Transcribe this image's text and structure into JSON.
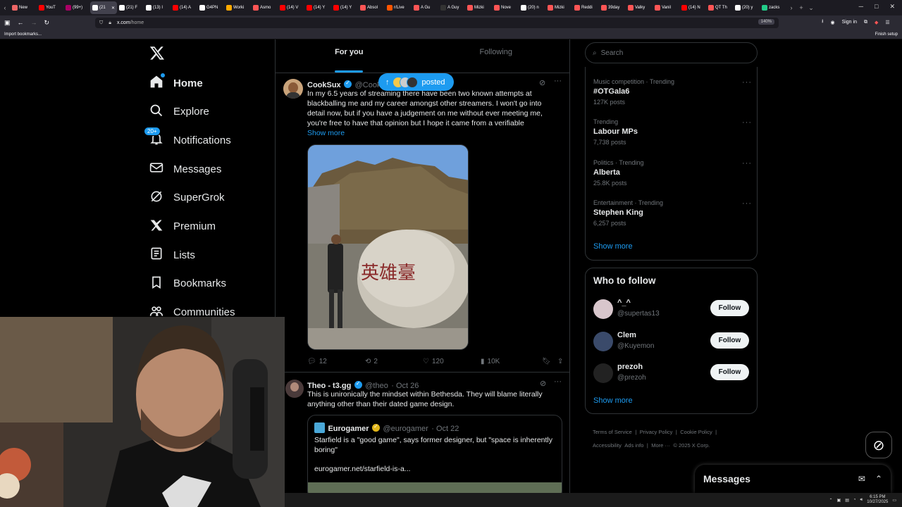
{
  "browser": {
    "tabs": [
      {
        "label": "New",
        "color": "#e66"
      },
      {
        "label": "YouT",
        "color": "#f00"
      },
      {
        "label": "(99+)",
        "color": "#a06"
      },
      {
        "label": "(21",
        "color": "#fff",
        "active": true
      },
      {
        "label": "(21) F",
        "color": "#fff"
      },
      {
        "label": "(13) I",
        "color": "#fff"
      },
      {
        "label": "(14) A",
        "color": "#f00"
      },
      {
        "label": "G4PN",
        "color": "#fff"
      },
      {
        "label": "Worki",
        "color": "#fa0"
      },
      {
        "label": "Asmo",
        "color": "#f55"
      },
      {
        "label": "(14) V",
        "color": "#f00"
      },
      {
        "label": "(14) Y",
        "color": "#f00"
      },
      {
        "label": "(14) Y",
        "color": "#f00"
      },
      {
        "label": "Absol",
        "color": "#f55"
      },
      {
        "label": "r/Live",
        "color": "#f50"
      },
      {
        "label": "A Gu",
        "color": "#f55"
      },
      {
        "label": "A Guy",
        "color": "#333"
      },
      {
        "label": "Mizki",
        "color": "#f55"
      },
      {
        "label": "Nove",
        "color": "#f55"
      },
      {
        "label": "(20) n",
        "color": "#fff"
      },
      {
        "label": "Mizki",
        "color": "#f55"
      },
      {
        "label": "Reddi",
        "color": "#f55"
      },
      {
        "label": "39day",
        "color": "#f55"
      },
      {
        "label": "Valky",
        "color": "#f55"
      },
      {
        "label": "Vanil",
        "color": "#f55"
      },
      {
        "label": "(14) N",
        "color": "#f00"
      },
      {
        "label": "QT Th",
        "color": "#f55"
      },
      {
        "label": "(20) y",
        "color": "#fff"
      },
      {
        "label": "zacks",
        "color": "#2c8"
      }
    ],
    "url": "x.com",
    "url_path": "/home",
    "zoom": "140%",
    "sign_in": "Sign in",
    "import_bookmarks": "Import bookmarks...",
    "finish_setup": "Finish setup"
  },
  "sidebar": {
    "items": [
      {
        "label": "Home",
        "icon": "home-icon"
      },
      {
        "label": "Explore",
        "icon": "search-icon"
      },
      {
        "label": "Notifications",
        "icon": "bell-icon",
        "badge": "20+"
      },
      {
        "label": "Messages",
        "icon": "mail-icon"
      },
      {
        "label": "SuperGrok",
        "icon": "grok-icon"
      },
      {
        "label": "Premium",
        "icon": "x-icon"
      },
      {
        "label": "Lists",
        "icon": "list-icon"
      },
      {
        "label": "Bookmarks",
        "icon": "bookmark-icon"
      },
      {
        "label": "Communities",
        "icon": "communities-icon"
      }
    ]
  },
  "feed": {
    "tabs": [
      "For you",
      "Following"
    ],
    "new_posts_pill": "posted",
    "tweets": [
      {
        "name": "CookSux",
        "handle": "@Cook",
        "lines": [
          "In my 6.5 years of streaming there have been two known attempts at",
          "blackballing me and my career amongst other streamers. I won't go into",
          "detail now, but if you have a judgement on me without ever meeting me,",
          "you're free to have that opinion but I hope it came from a verifiable"
        ],
        "show_more": "Show more",
        "stone_text": "英雄臺",
        "replies": "12",
        "reposts": "2",
        "likes": "120",
        "views": "10K"
      },
      {
        "name": "Theo - t3.gg",
        "handle": "@theo",
        "date": "· Oct 26",
        "lines": [
          "This is unironically the mindset within Bethesda. They will blame literally",
          "anything other than their dated game design."
        ],
        "quote": {
          "name": "Eurogamer",
          "handle": "@eurogamer",
          "date": "· Oct 22",
          "lines": [
            "Starfield is a \"good game\", says former designer, but \"space is inherently",
            "boring\""
          ],
          "link": "eurogamer.net/starfield-is-a..."
        }
      }
    ]
  },
  "right": {
    "search_placeholder": "Search",
    "trends": [
      {
        "meta": "Music competition · Trending",
        "name": "#OTGala6",
        "posts": "127K posts"
      },
      {
        "meta": "Trending",
        "name": "Labour MPs",
        "posts": "7,738 posts"
      },
      {
        "meta": "Politics · Trending",
        "name": "Alberta",
        "posts": "25.8K posts"
      },
      {
        "meta": "Entertainment · Trending",
        "name": "Stephen King",
        "posts": "6,257 posts"
      }
    ],
    "trends_show_more": "Show more",
    "who_to_follow_title": "Who to follow",
    "follow_suggestions": [
      {
        "name": "^_^",
        "handle": "@supertas13",
        "button": "Follow",
        "avatar_color": "#d8c6cc"
      },
      {
        "name": "Clem",
        "handle": "@Kuyemon",
        "button": "Follow",
        "avatar_color": "#3a4a6a"
      },
      {
        "name": "prezoh",
        "handle": "@prezoh",
        "button": "Follow",
        "avatar_color": "#222"
      }
    ],
    "follow_show_more": "Show more",
    "footer": [
      "Terms of Service",
      "|",
      "Privacy Policy",
      "|",
      "Cookie Policy",
      "|",
      "Accessibility",
      "Ads info",
      "|",
      "More ···",
      "© 2025 X Corp."
    ]
  },
  "messages_drawer": {
    "title": "Messages"
  },
  "taskbar": {
    "time": "6:15 PM",
    "date": "10/27/2025"
  },
  "colors": {
    "accent": "#1d9bf0",
    "border": "#2f3336",
    "muted": "#71767b"
  }
}
